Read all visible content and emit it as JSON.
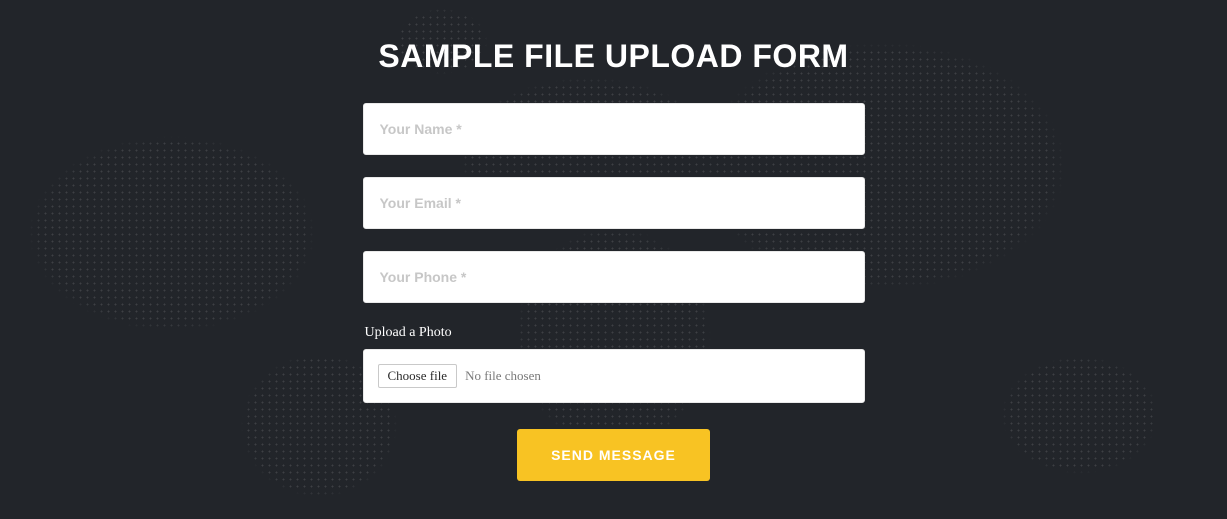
{
  "title": "SAMPLE FILE UPLOAD FORM",
  "fields": {
    "name_placeholder": "Your Name *",
    "email_placeholder": "Your Email *",
    "phone_placeholder": "Your Phone *"
  },
  "upload": {
    "label": "Upload a Photo",
    "choose_label": "Choose file",
    "status": "No file chosen"
  },
  "submit_label": "SEND MESSAGE",
  "colors": {
    "background": "#22252a",
    "accent": "#f8c323",
    "field_bg": "#ffffff"
  }
}
